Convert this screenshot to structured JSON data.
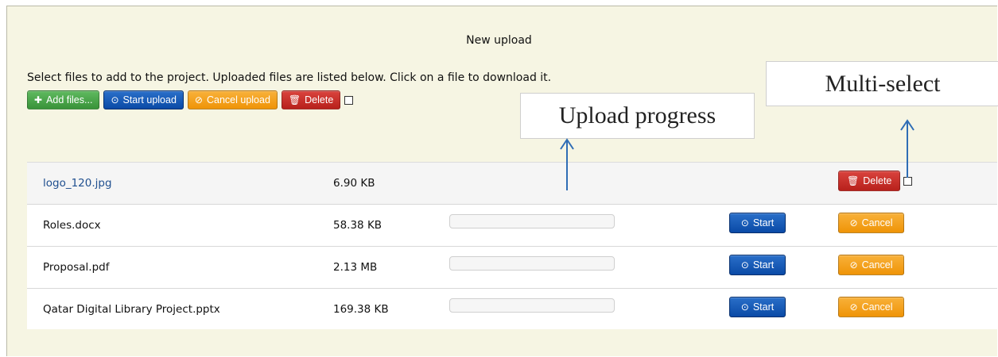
{
  "heading": "New upload",
  "instructions": "Select files to add to the project. Uploaded files are listed below. Click on a file to download it.",
  "toolbar": {
    "add_files": {
      "label": "Add files...",
      "icon": "plus-icon"
    },
    "start_upload": {
      "label": "Start upload",
      "icon": "upload-circle-icon"
    },
    "cancel_upload": {
      "label": "Cancel upload",
      "icon": "ban-icon"
    },
    "delete": {
      "label": "Delete",
      "icon": "trash-icon"
    },
    "select_all_checked": false
  },
  "annotations": {
    "upload_progress": "Upload progress",
    "multi_select": "Multi-select"
  },
  "files": [
    {
      "name": "logo_120.jpg",
      "size": "6.90 KB",
      "uploaded": true,
      "action": "Delete",
      "selected": false
    },
    {
      "name": "Roles.docx",
      "size": "58.38 KB",
      "uploaded": false,
      "start": "Start",
      "cancel": "Cancel",
      "progress": 0
    },
    {
      "name": "Proposal.pdf",
      "size": "2.13 MB",
      "uploaded": false,
      "start": "Start",
      "cancel": "Cancel",
      "progress": 0
    },
    {
      "name": "Qatar Digital Library Project.pptx",
      "size": "169.38 KB",
      "uploaded": false,
      "start": "Start",
      "cancel": "Cancel",
      "progress": 0
    }
  ],
  "colors": {
    "background": "#f6f5e3",
    "add_button": "#47a447",
    "start_button": "#0a4aa6",
    "cancel_button": "#f39c12",
    "delete_button": "#c9302c",
    "arrow": "#2f6db5"
  }
}
